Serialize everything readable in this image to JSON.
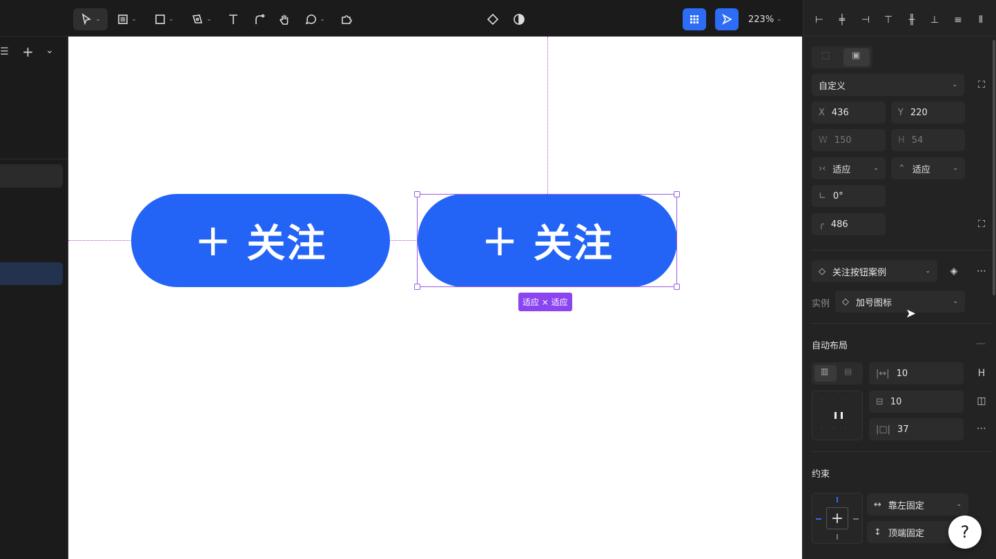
{
  "toolbar": {
    "zoom": "223%",
    "tools": [
      "move-tool",
      "frame-tool",
      "shape-tool",
      "pen-tool",
      "text-tool",
      "connector-tool",
      "hand-tool",
      "comment-tool",
      "plugin-tool"
    ]
  },
  "left_panel": {
    "icons": [
      "list-icon",
      "plus-icon",
      "chevron-down-icon"
    ]
  },
  "canvas": {
    "button_left": {
      "plus": "+",
      "label": "关注"
    },
    "button_right": {
      "plus": "+",
      "label": "关注"
    },
    "size_tag": "适应 × 适应"
  },
  "right_panel": {
    "frame_preset": "自定义",
    "x_label": "X",
    "x_value": "436",
    "y_label": "Y",
    "y_value": "220",
    "w_label": "W",
    "w_value": "150",
    "h_label": "H",
    "h_value": "54",
    "width_mode": "适应",
    "height_mode": "适应",
    "rotation": "0°",
    "radius": "486",
    "component_name": "关注按钮案例",
    "instance_label": "实例",
    "instance_value": "加号图标",
    "auto_layout_title": "自动布局",
    "gap": "10",
    "padding_v": "10",
    "padding_h": "37",
    "constraints_title": "约束",
    "constraint_h": "靠左固定",
    "constraint_v": "顶端固定",
    "help": "?"
  },
  "colors": {
    "accent": "#2d6cf5",
    "button_fill": "#2364f6",
    "selection": "#9b59e8"
  }
}
